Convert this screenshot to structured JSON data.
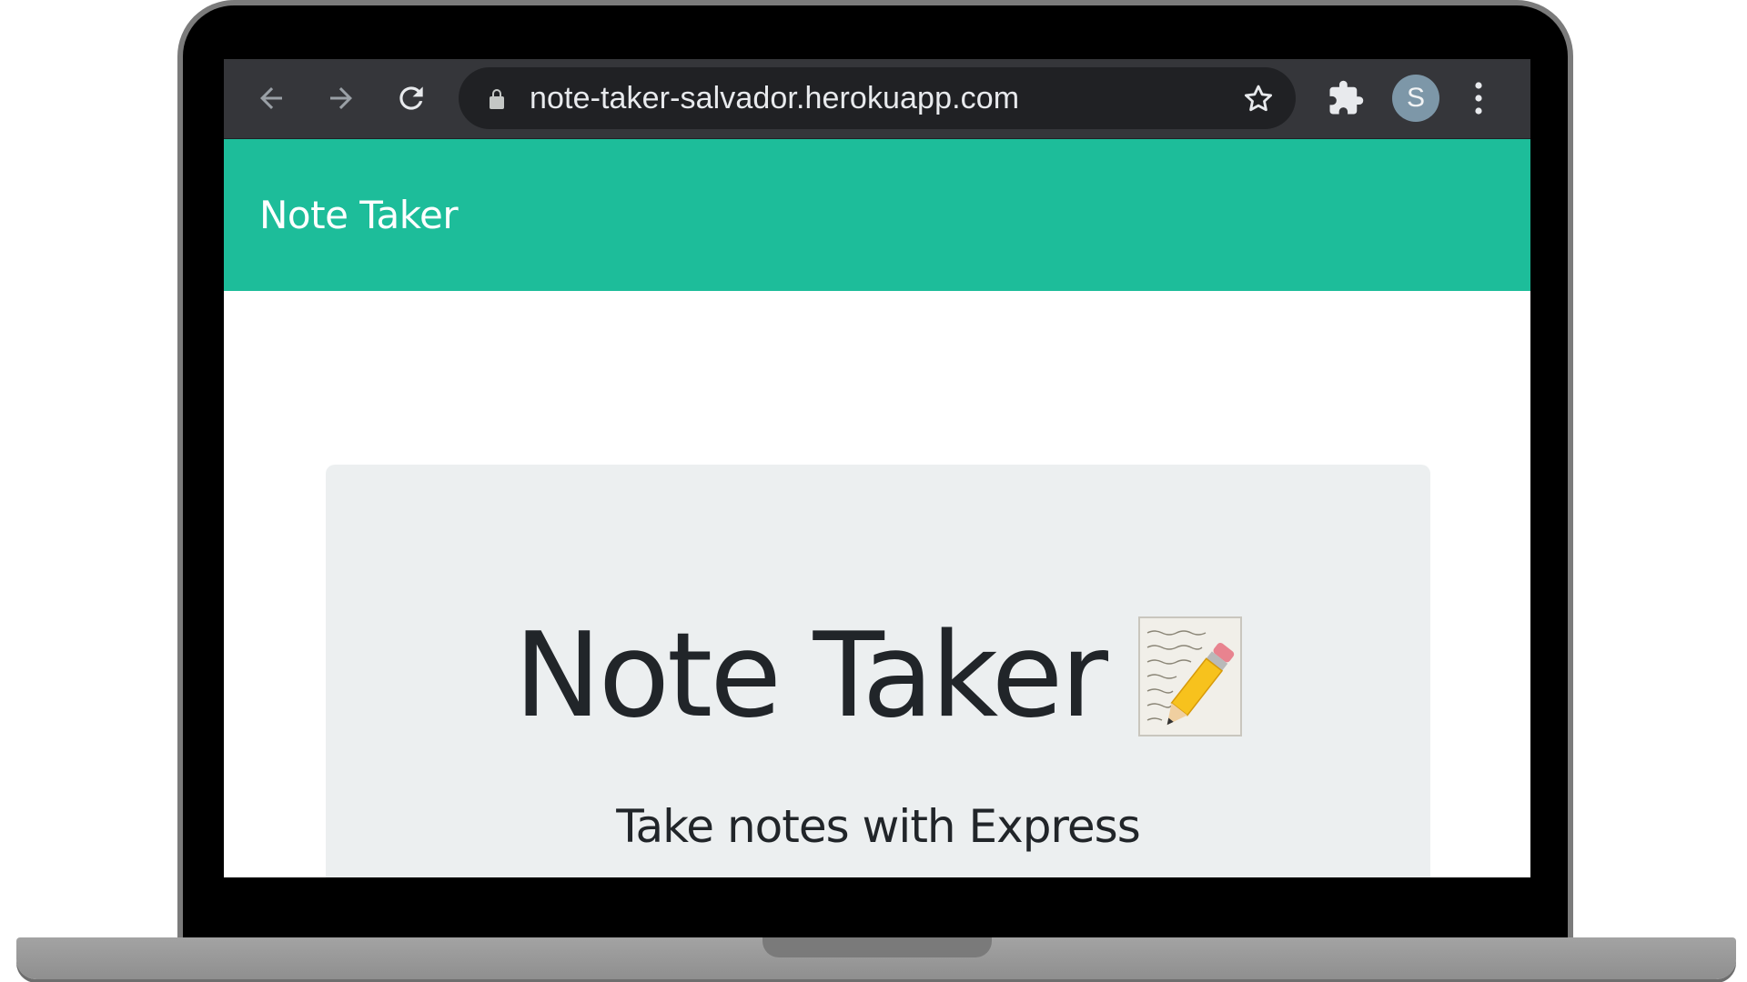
{
  "browser": {
    "url": "note-taker-salvador.herokuapp.com",
    "avatar_initial": "S",
    "icons": {
      "back": "arrow-left-icon",
      "forward": "arrow-right-icon",
      "reload": "reload-icon",
      "lock": "lock-icon",
      "bookmark": "star-icon",
      "extensions": "puzzle-piece-icon",
      "menu": "vertical-dots-icon"
    }
  },
  "navbar": {
    "brand": "Note Taker"
  },
  "jumbotron": {
    "title": "Note Taker",
    "title_icon": "memo-icon",
    "lead": "Take notes with Express"
  },
  "colors": {
    "navbar": "#1dbd9a",
    "jumbotron": "#eceff0",
    "browser_toolbar": "#35363a",
    "omnibox": "#202124",
    "avatar": "#7d97a8"
  }
}
